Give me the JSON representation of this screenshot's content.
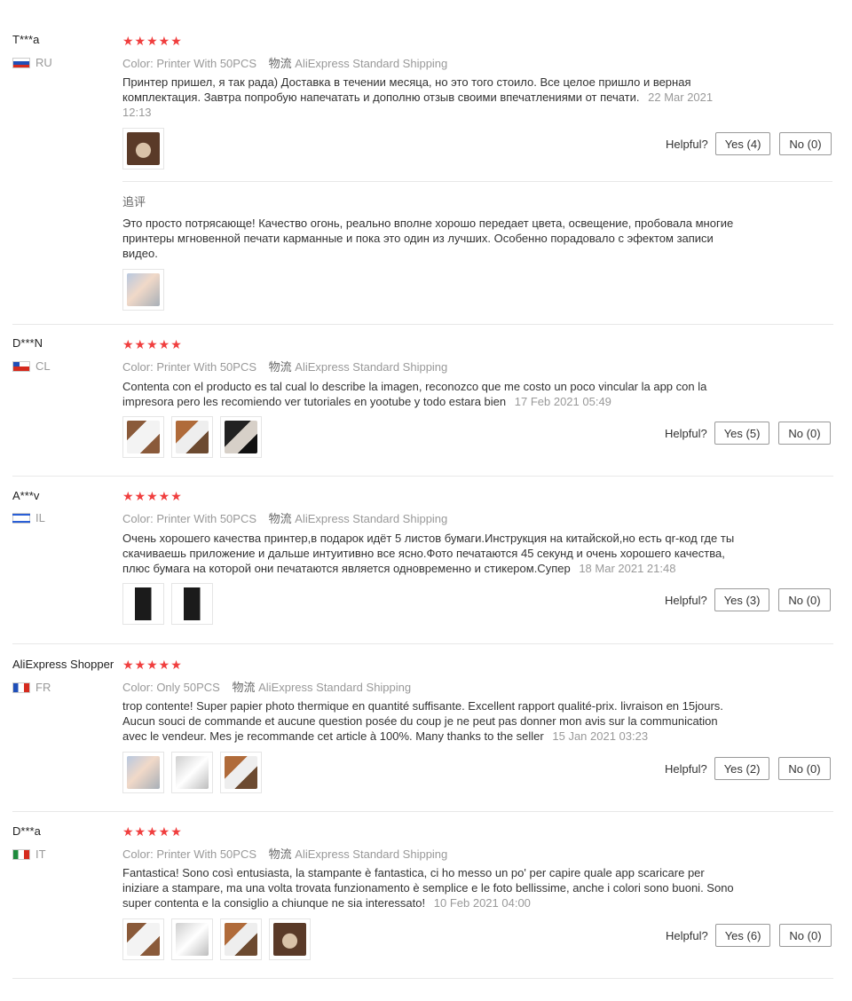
{
  "labels": {
    "color": "Color:",
    "shipping": "物流",
    "helpful": "Helpful?",
    "additional": "追评"
  },
  "reviews": [
    {
      "user": "T***a",
      "country": "RU",
      "stars": "★★★★★",
      "color_value": "Printer With 50PCS",
      "shipping_value": "AliExpress Standard Shipping",
      "text": "Принтер пришел, я так рада) Доставка в течении месяца, но это того стоило. Все целое пришло и верная комплектация. Завтра попробую напечатать и дополню отзыв своими впечатлениями от печати.",
      "date": "22 Mar 2021 12:13",
      "yes": "Yes (4)",
      "no": "No (0)",
      "followup_text": "Это просто потрясающе! Качество огонь, реально вполне хорошо передает цвета, освещение, пробовала многие принтеры мгновенной печати карманные и пока это один из лучших. Особенно порадовало с эфектом записи видео."
    },
    {
      "user": "D***N",
      "country": "CL",
      "stars": "★★★★★",
      "color_value": "Printer With 50PCS",
      "shipping_value": "AliExpress Standard Shipping",
      "text": "Contenta con el producto es tal cual lo describe la imagen, reconozco que me costo un poco vincular la app con la impresora pero les recomiendo ver tutoriales en yootube y todo estara bien",
      "date": "17 Feb 2021 05:49",
      "yes": "Yes (5)",
      "no": "No (0)"
    },
    {
      "user": "A***v",
      "country": "IL",
      "stars": "★★★★★",
      "color_value": "Printer With 50PCS",
      "shipping_value": "AliExpress Standard Shipping",
      "text": "Очень хорошего качества принтер,в подарок идёт 5 листов бумаги.Инструкция на китайской,но есть qr-код где ты скачиваешь приложение и дальше интуитивно все ясно.Фото печатаются 45 секунд и очень хорошего качества, плюс бумага на которой они печатаются является одновременно и стикером.Супер",
      "date": "18 Mar 2021 21:48",
      "yes": "Yes (3)",
      "no": "No (0)"
    },
    {
      "user": "AliExpress Shopper",
      "country": "FR",
      "stars": "★★★★★",
      "color_value": "Only 50PCS",
      "shipping_value": "AliExpress Standard Shipping",
      "text": "trop contente! Super papier photo thermique en quantité suffisante. Excellent rapport qualité-prix. livraison en 15jours. Aucun souci de commande et aucune question posée du coup je ne peut pas donner mon avis sur la communication avec le vendeur. Mes je recommande cet article à 100%. Many thanks to the seller",
      "date": "15 Jan 2021 03:23",
      "yes": "Yes (2)",
      "no": "No (0)"
    },
    {
      "user": "D***a",
      "country": "IT",
      "stars": "★★★★★",
      "color_value": "Printer With 50PCS",
      "shipping_value": "AliExpress Standard Shipping",
      "text": "Fantastica! Sono così entusiasta, la stampante è fantastica, ci ho messo un po' per capire quale app scaricare per iniziare a stampare, ma una volta trovata funzionamento è semplice e le foto bellissime, anche i colori sono buoni. Sono super contenta e la consiglio a chiunque ne sia interessato!",
      "date": "10 Feb 2021 04:00",
      "yes": "Yes (6)",
      "no": "No (0)"
    }
  ]
}
